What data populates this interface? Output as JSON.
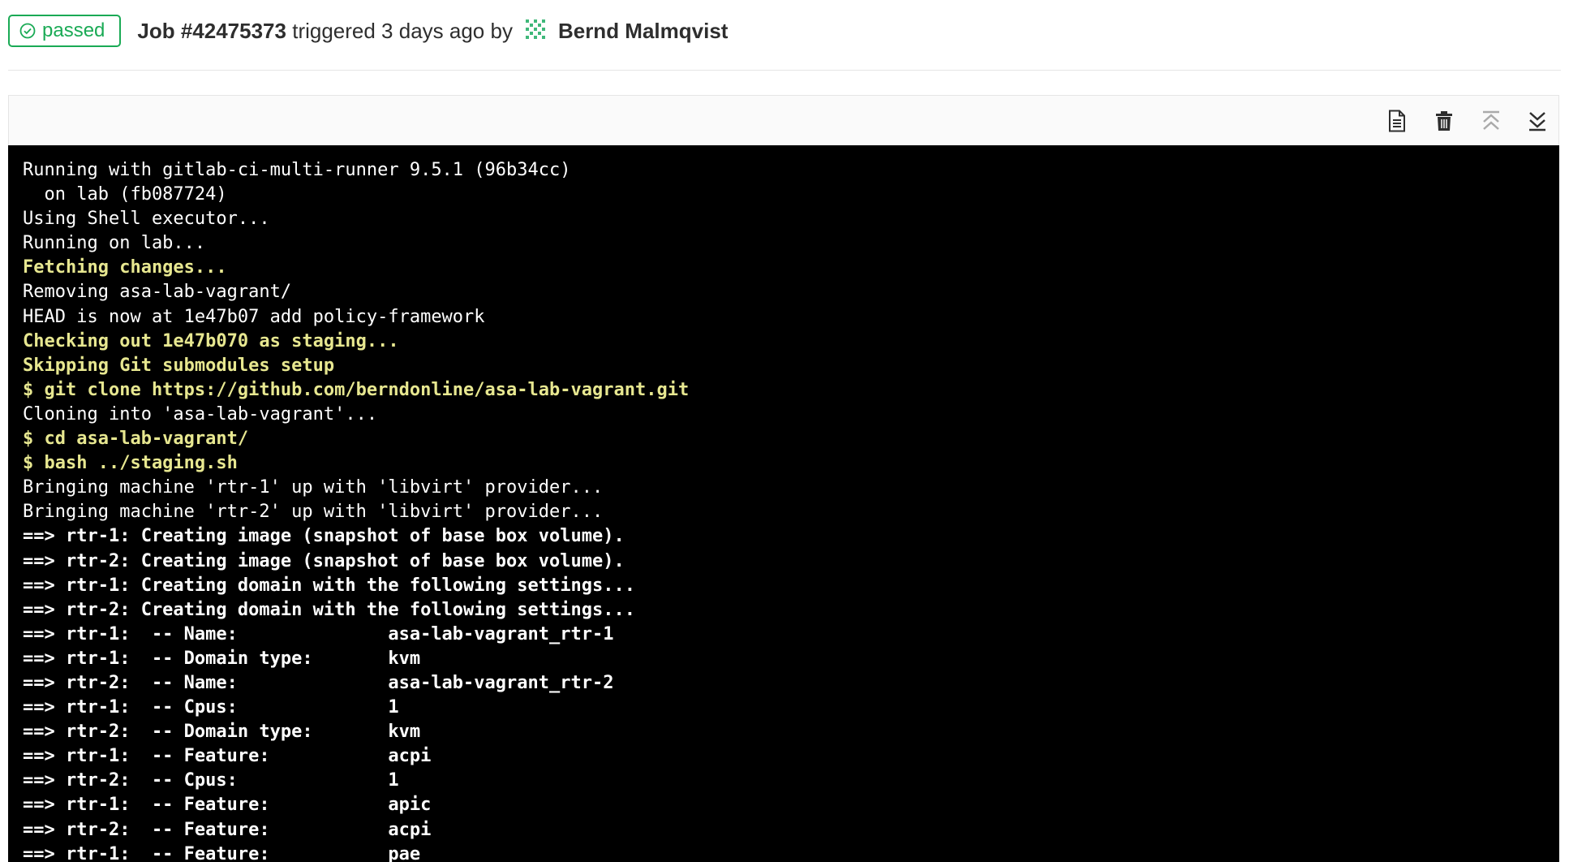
{
  "header": {
    "status": "passed",
    "job_label": "Job #42475373",
    "triggered_text": "triggered 3 days ago by",
    "user": "Bernd Malmqvist"
  },
  "colors": {
    "status_passed": "#1aaa55",
    "terminal_bg": "#000000",
    "log_text": "#ffffff",
    "log_highlight": "#e7e790"
  },
  "toolbar": {
    "icons": [
      "raw-log-icon",
      "erase-icon",
      "scroll-top-icon",
      "scroll-bottom-icon"
    ]
  },
  "log": [
    {
      "text": "Running with gitlab-ci-multi-runner 9.5.1 (96b34cc)",
      "style": "n"
    },
    {
      "text": "  on lab (fb087724)",
      "style": "n"
    },
    {
      "text": "Using Shell executor...",
      "style": "n"
    },
    {
      "text": "Running on lab...",
      "style": "n"
    },
    {
      "text": "Fetching changes...",
      "style": "y"
    },
    {
      "text": "Removing asa-lab-vagrant/",
      "style": "n"
    },
    {
      "text": "HEAD is now at 1e47b07 add policy-framework",
      "style": "n"
    },
    {
      "text": "Checking out 1e47b070 as staging...",
      "style": "y"
    },
    {
      "text": "Skipping Git submodules setup",
      "style": "y"
    },
    {
      "text": "$ git clone https://github.com/berndonline/asa-lab-vagrant.git",
      "style": "y"
    },
    {
      "text": "Cloning into 'asa-lab-vagrant'...",
      "style": "n"
    },
    {
      "text": "$ cd asa-lab-vagrant/",
      "style": "y"
    },
    {
      "text": "$ bash ../staging.sh",
      "style": "y"
    },
    {
      "text": "Bringing machine 'rtr-1' up with 'libvirt' provider...",
      "style": "n"
    },
    {
      "text": "Bringing machine 'rtr-2' up with 'libvirt' provider...",
      "style": "n"
    },
    {
      "text": "==> rtr-1: Creating image (snapshot of base box volume).",
      "style": "b"
    },
    {
      "text": "==> rtr-2: Creating image (snapshot of base box volume).",
      "style": "b"
    },
    {
      "text": "==> rtr-1: Creating domain with the following settings...",
      "style": "b"
    },
    {
      "text": "==> rtr-2: Creating domain with the following settings...",
      "style": "b"
    },
    {
      "text": "==> rtr-1:  -- Name:              asa-lab-vagrant_rtr-1",
      "style": "b"
    },
    {
      "text": "==> rtr-1:  -- Domain type:       kvm",
      "style": "b"
    },
    {
      "text": "==> rtr-2:  -- Name:              asa-lab-vagrant_rtr-2",
      "style": "b"
    },
    {
      "text": "==> rtr-1:  -- Cpus:              1",
      "style": "b"
    },
    {
      "text": "==> rtr-2:  -- Domain type:       kvm",
      "style": "b"
    },
    {
      "text": "==> rtr-1:  -- Feature:           acpi",
      "style": "b"
    },
    {
      "text": "==> rtr-2:  -- Cpus:              1",
      "style": "b"
    },
    {
      "text": "==> rtr-1:  -- Feature:           apic",
      "style": "b"
    },
    {
      "text": "==> rtr-2:  -- Feature:           acpi",
      "style": "b"
    },
    {
      "text": "==> rtr-1:  -- Feature:           pae",
      "style": "b"
    }
  ]
}
